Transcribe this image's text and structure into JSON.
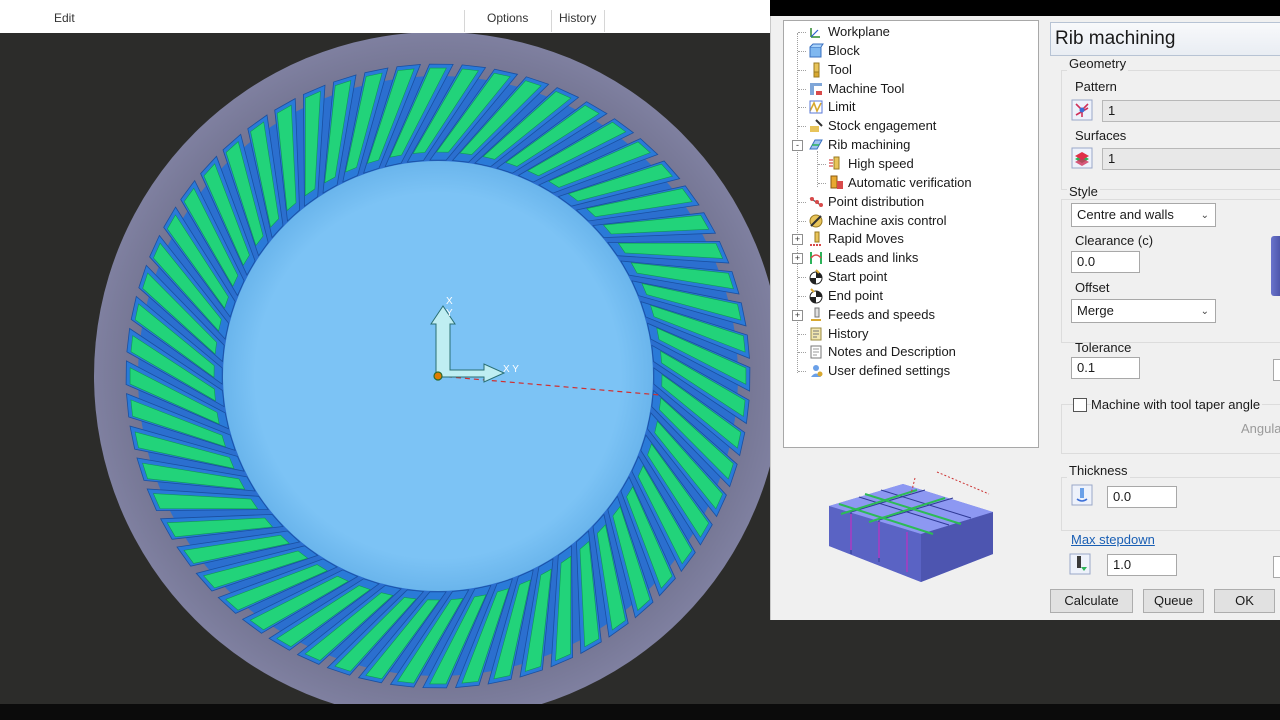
{
  "menu": {
    "edit": "Edit",
    "options": "Options",
    "history": "History"
  },
  "tree": {
    "items": [
      {
        "label": "Workplane",
        "icon": "workplane-icon"
      },
      {
        "label": "Block",
        "icon": "block-icon"
      },
      {
        "label": "Tool",
        "icon": "tool-icon"
      },
      {
        "label": "Machine Tool",
        "icon": "machine-tool-icon"
      },
      {
        "label": "Limit",
        "icon": "limit-icon"
      },
      {
        "label": "Stock engagement",
        "icon": "stock-engagement-icon"
      },
      {
        "label": "Rib machining",
        "icon": "rib-machining-icon"
      },
      {
        "label": "High speed",
        "icon": "high-speed-icon"
      },
      {
        "label": "Automatic verification",
        "icon": "automatic-verification-icon"
      },
      {
        "label": "Point distribution",
        "icon": "point-distribution-icon"
      },
      {
        "label": "Machine axis control",
        "icon": "machine-axis-control-icon"
      },
      {
        "label": "Rapid Moves",
        "icon": "rapid-moves-icon"
      },
      {
        "label": "Leads and links",
        "icon": "leads-and-links-icon"
      },
      {
        "label": "Start point",
        "icon": "start-point-icon"
      },
      {
        "label": "End point",
        "icon": "end-point-icon"
      },
      {
        "label": "Feeds and speeds",
        "icon": "feeds-and-speeds-icon"
      },
      {
        "label": "History",
        "icon": "history-icon"
      },
      {
        "label": "Notes and Description",
        "icon": "notes-icon"
      },
      {
        "label": "User defined settings",
        "icon": "user-settings-icon"
      }
    ]
  },
  "form": {
    "title": "Rib machining",
    "geometry_label": "Geometry",
    "pattern_label": "Pattern",
    "pattern_value": "1",
    "surfaces_label": "Surfaces",
    "surfaces_value": "1",
    "style_label": "Style",
    "style_value": "Centre and walls",
    "clearance_label": "Clearance (c)",
    "clearance_value": "0.0",
    "offset_label": "Offset",
    "offset_value": "Merge",
    "tolerance_label": "Tolerance",
    "tolerance_value": "0.1",
    "taper_label": "Machine with tool taper angle",
    "angle_label": "Angula",
    "thickness_label": "Thickness",
    "thickness_value": "0.0",
    "max_stepdown_label": "Max stepdown",
    "max_stepdown_value": "1.0",
    "calculate_label": "Calculate",
    "queue_label": "Queue",
    "ok_label": "OK"
  },
  "viewport": {
    "axis_x_label": "X",
    "axis_y_label": "Y",
    "axis_xy_label": "X Y",
    "colors": {
      "background": "#2c2c2a",
      "outer_disc": "#7b7c98",
      "inner_disc": "#7cc3f5",
      "teeth": "#2a7ad8",
      "toolpath": "#22d37a"
    }
  }
}
